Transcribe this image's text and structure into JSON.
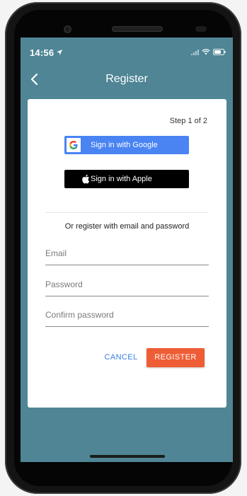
{
  "status_bar": {
    "time": "14:56"
  },
  "app_bar": {
    "title": "Register",
    "back_icon": "chevron-left-icon"
  },
  "card": {
    "step_label": "Step 1 of 2",
    "google_button": {
      "label": "Sign in with Google",
      "icon": "google-icon",
      "logo_letter": "G",
      "color": "#4a84f3"
    },
    "apple_button": {
      "label": "Sign in with Apple",
      "icon": "apple-icon",
      "color": "#000000"
    },
    "or_text": "Or register with email and password",
    "fields": {
      "email_placeholder": "Email",
      "password_placeholder": "Password",
      "confirm_placeholder": "Confirm password"
    },
    "cancel_label": "CANCEL",
    "register_label": "REGISTER"
  },
  "colors": {
    "screen_background": "#4f8595",
    "register_accent": "#ee5d35",
    "cancel_text": "#3a80e0"
  }
}
